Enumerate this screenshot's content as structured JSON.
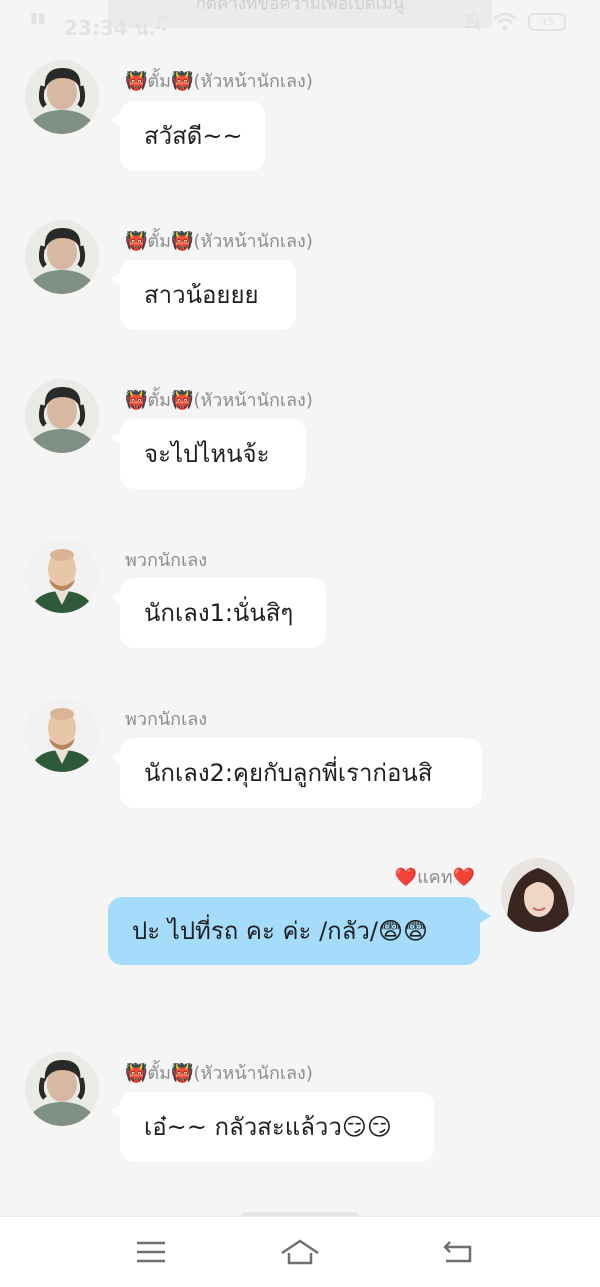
{
  "status": {
    "time": "23:34 น.",
    "battery": "45",
    "notice": "กดค้างที่ข้อความเพื่อเปิดเมนู"
  },
  "messages": [
    {
      "sender": "👹ตั้ม👹(หัวหน้านักเลง)",
      "text": "สวัสดี~~",
      "side": "left"
    },
    {
      "sender": "👹ตั้ม👹(หัวหน้านักเลง)",
      "text": "สาวน้อยยย",
      "side": "left"
    },
    {
      "sender": "👹ตั้ม👹(หัวหน้านักเลง)",
      "text": "จะไปไหนจ้ะ",
      "side": "left"
    },
    {
      "sender": "พวกนักเลง",
      "text": "นักเลง1:นั่นสิๆ",
      "side": "left"
    },
    {
      "sender": "พวกนักเลง",
      "text": "นักเลง2:คุยกับลูกพี่เราก่อนสิ",
      "side": "left"
    },
    {
      "sender": "❤️แคท❤️",
      "text": "ปะ ไปที่รถ คะ ค่ะ /กลัว/😨😨",
      "side": "right"
    },
    {
      "sender": "👹ตั้ม👹(หัวหน้านักเลง)",
      "text": "เอ๋~~ กลัวสะแล้วว😏😏",
      "side": "left"
    }
  ],
  "icons": {
    "menu": "menu-icon",
    "home": "home-icon",
    "back": "back-icon"
  },
  "colors": {
    "background": "#f5f5f5",
    "bubble_in": "#ffffff",
    "bubble_out": "#a5dcfb",
    "sender_text": "#8d8d8d"
  }
}
